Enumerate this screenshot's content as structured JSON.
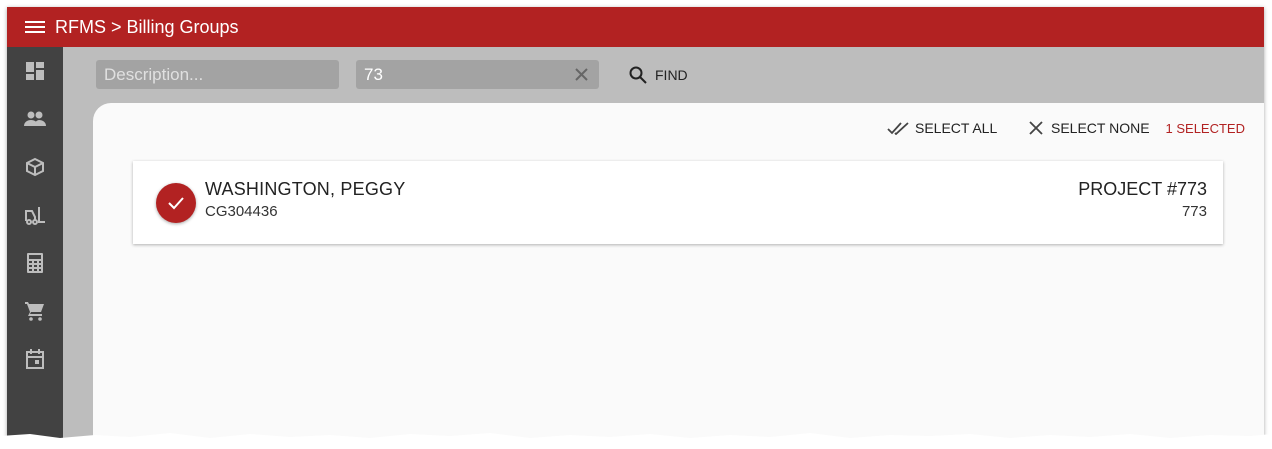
{
  "topbar": {
    "title": "RFMS > Billing Groups"
  },
  "sidebar": {
    "items": [
      {
        "icon": "dashboard-icon"
      },
      {
        "icon": "people-icon"
      },
      {
        "icon": "package-icon"
      },
      {
        "icon": "forklift-icon"
      },
      {
        "icon": "calculator-icon"
      },
      {
        "icon": "cart-icon"
      },
      {
        "icon": "calendar-icon"
      }
    ]
  },
  "search": {
    "description_placeholder": "Description...",
    "description_value": "",
    "number_value": "73",
    "find_label": "FIND"
  },
  "selection": {
    "select_all_label": "SELECT ALL",
    "select_none_label": "SELECT NONE",
    "selected_count_label": "1 SELECTED"
  },
  "results": [
    {
      "name": "WASHINGTON, PEGGY",
      "code": "CG304436",
      "project": "PROJECT #773",
      "project_number": "773",
      "selected": true
    }
  ],
  "colors": {
    "brand": "#b22222",
    "sidebar": "#424242",
    "background": "#bdbdbd",
    "content": "#fafafa"
  }
}
